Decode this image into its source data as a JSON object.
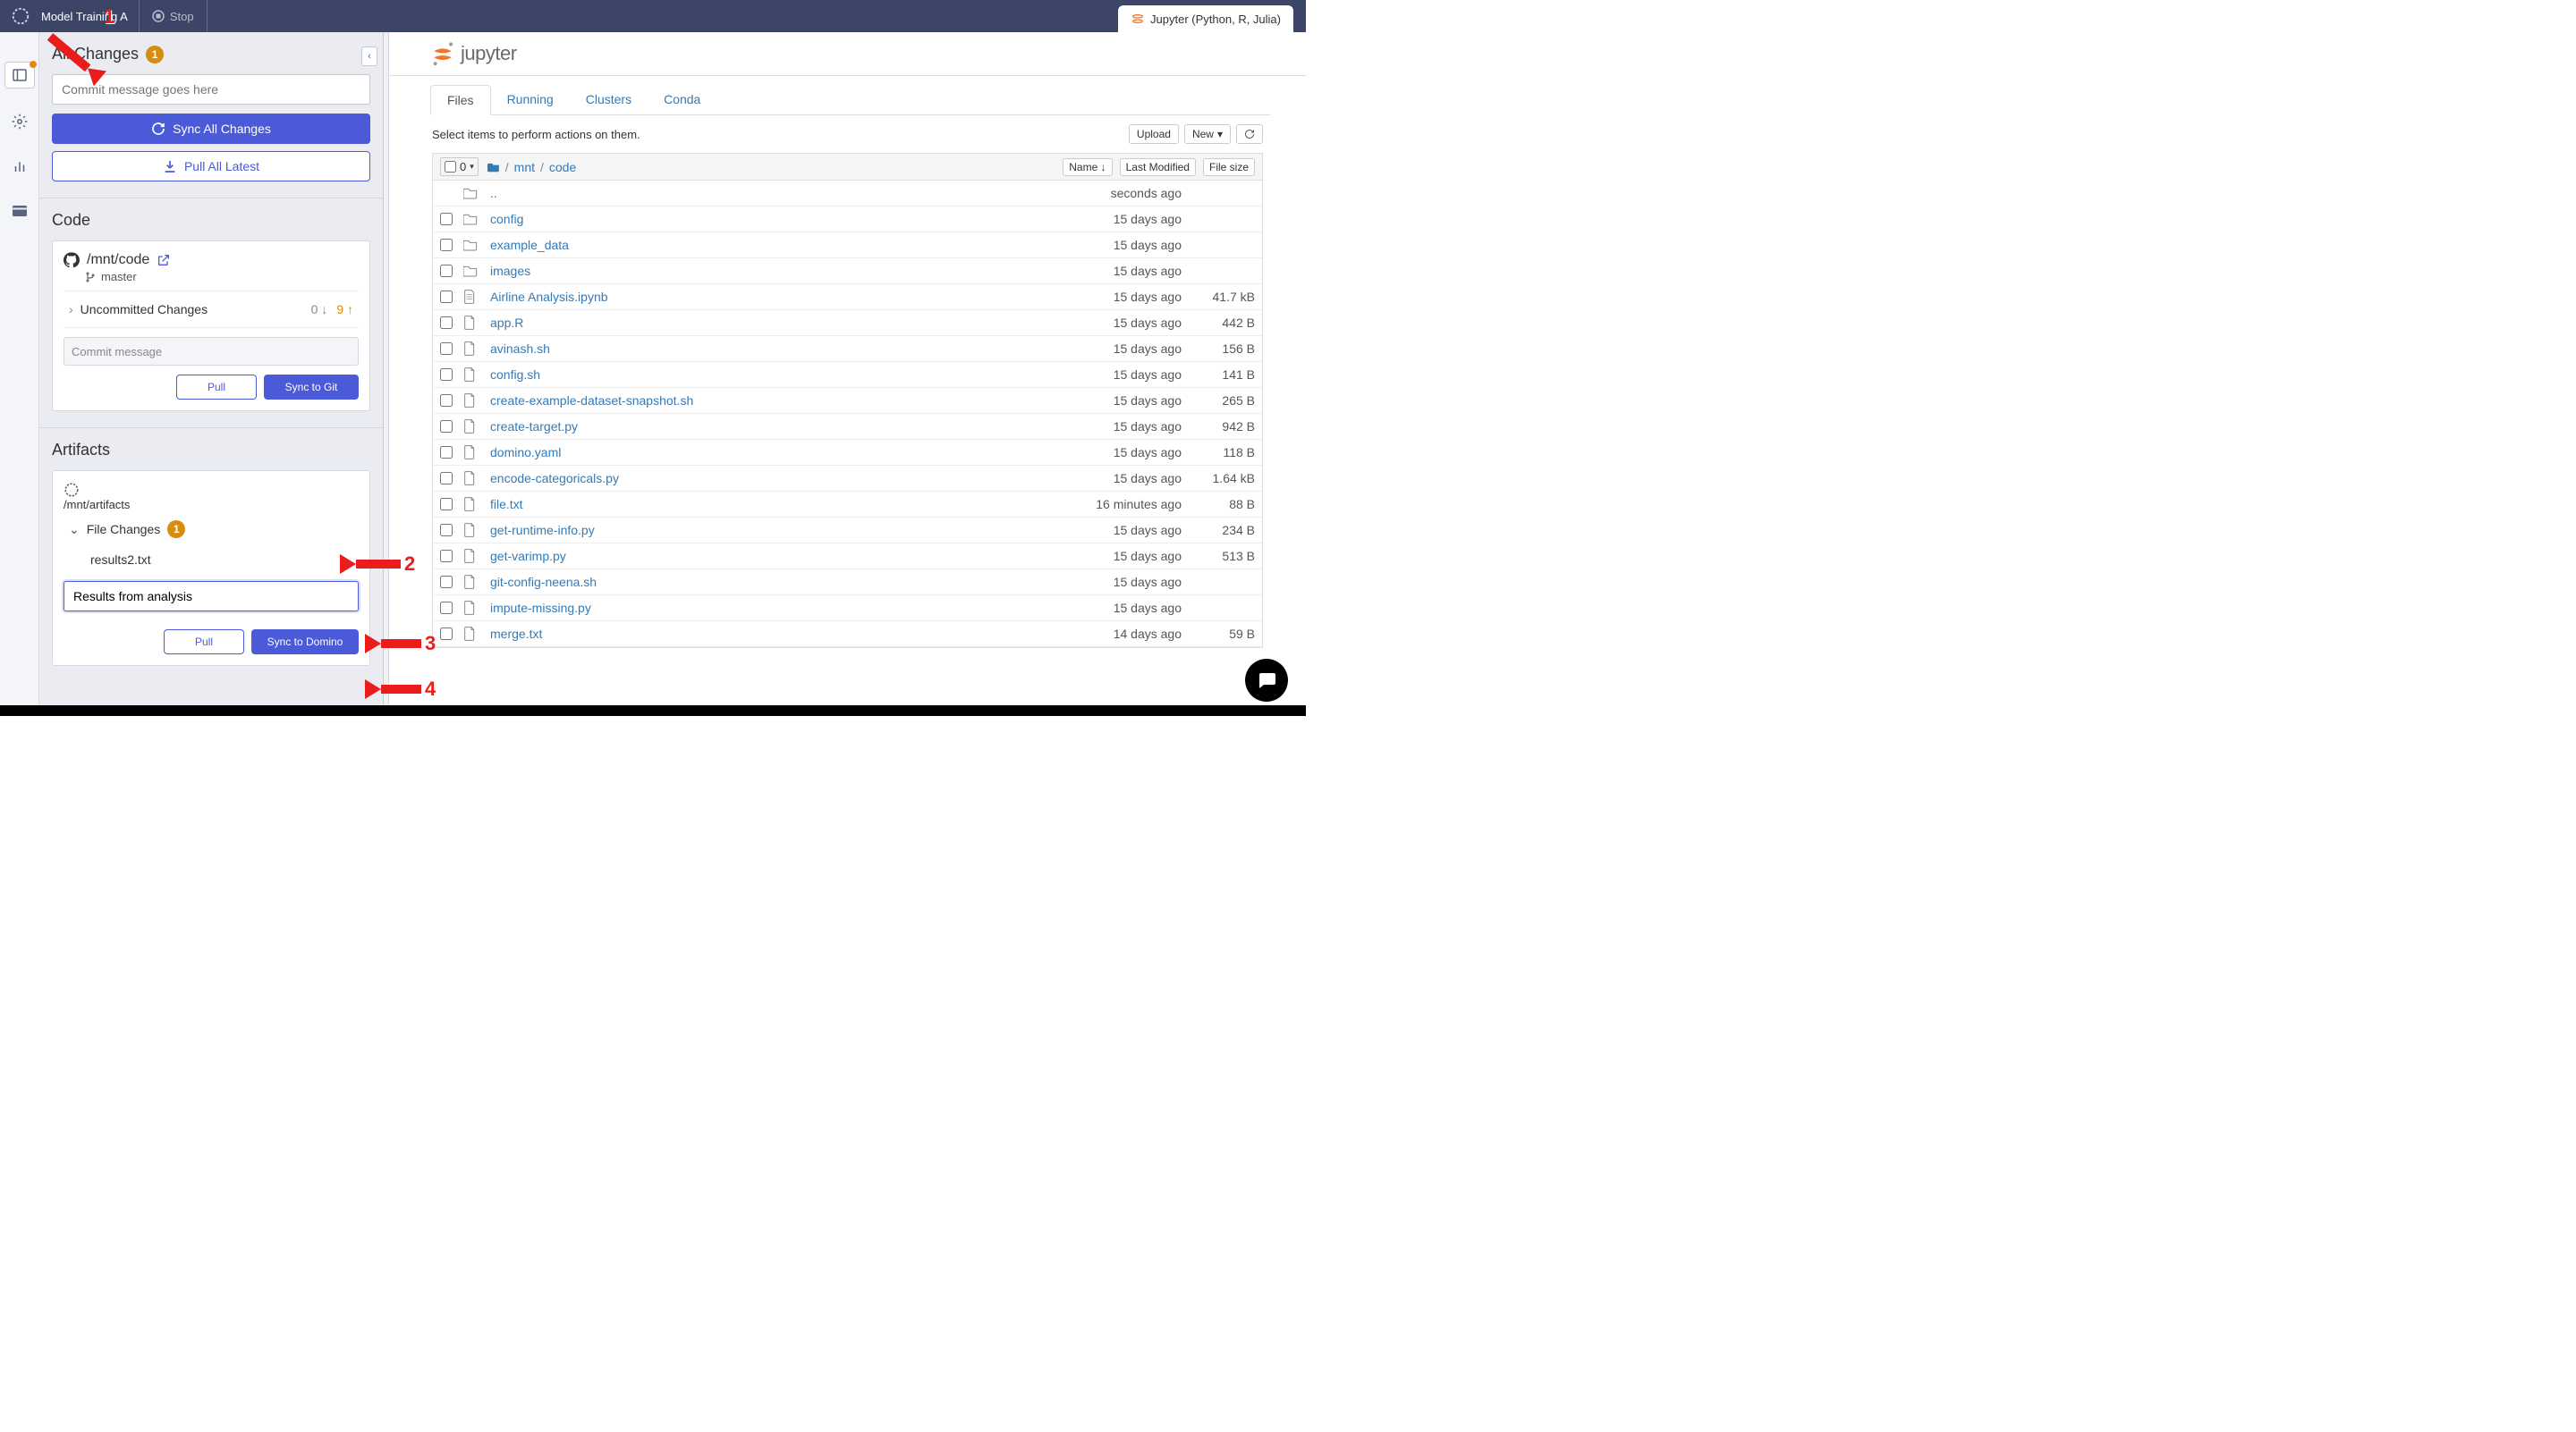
{
  "topbar": {
    "project_title": "Model Training A",
    "stop_label": "Stop",
    "tab_right": "Jupyter (Python, R, Julia)"
  },
  "panel": {
    "all_changes": {
      "title": "All Changes",
      "badge": "1",
      "commit_placeholder": "Commit message goes here",
      "sync_label": "Sync All Changes",
      "pull_label": "Pull All Latest"
    },
    "code": {
      "title": "Code",
      "path": "/mnt/code",
      "branch": "master",
      "uncommitted_label": "Uncommitted Changes",
      "incoming": "0",
      "outgoing": "9",
      "commit_placeholder": "Commit message",
      "pull_label": "Pull",
      "sync_label": "Sync to Git"
    },
    "artifacts": {
      "title": "Artifacts",
      "path": "/mnt/artifacts",
      "file_changes_label": "File Changes",
      "badge": "1",
      "file_name": "results2.txt",
      "commit_value": "Results from analysis",
      "pull_label": "Pull",
      "sync_label": "Sync to Domino"
    }
  },
  "jupyter": {
    "logo_text": "jupyter",
    "tabs": [
      "Files",
      "Running",
      "Clusters",
      "Conda"
    ],
    "active_tab": "Files",
    "hint": "Select items to perform actions on them.",
    "upload_label": "Upload",
    "new_label": "New",
    "count_checked": "0",
    "breadcrumb": [
      "mnt",
      "code"
    ],
    "header_name": "Name",
    "header_modified": "Last Modified",
    "header_size": "File size",
    "rows": [
      {
        "type": "up",
        "name": "..",
        "modified": "seconds ago",
        "size": ""
      },
      {
        "type": "folder",
        "name": "config",
        "modified": "15 days ago",
        "size": ""
      },
      {
        "type": "folder",
        "name": "example_data",
        "modified": "15 days ago",
        "size": ""
      },
      {
        "type": "folder",
        "name": "images",
        "modified": "15 days ago",
        "size": ""
      },
      {
        "type": "notebook",
        "name": "Airline Analysis.ipynb",
        "modified": "15 days ago",
        "size": "41.7 kB"
      },
      {
        "type": "file",
        "name": "app.R",
        "modified": "15 days ago",
        "size": "442 B"
      },
      {
        "type": "file",
        "name": "avinash.sh",
        "modified": "15 days ago",
        "size": "156 B"
      },
      {
        "type": "file",
        "name": "config.sh",
        "modified": "15 days ago",
        "size": "141 B"
      },
      {
        "type": "file",
        "name": "create-example-dataset-snapshot.sh",
        "modified": "15 days ago",
        "size": "265 B"
      },
      {
        "type": "file",
        "name": "create-target.py",
        "modified": "15 days ago",
        "size": "942 B"
      },
      {
        "type": "file",
        "name": "domino.yaml",
        "modified": "15 days ago",
        "size": "118 B"
      },
      {
        "type": "file",
        "name": "encode-categoricals.py",
        "modified": "15 days ago",
        "size": "1.64 kB"
      },
      {
        "type": "file",
        "name": "file.txt",
        "modified": "16 minutes ago",
        "size": "88 B"
      },
      {
        "type": "file",
        "name": "get-runtime-info.py",
        "modified": "15 days ago",
        "size": "234 B"
      },
      {
        "type": "file",
        "name": "get-varimp.py",
        "modified": "15 days ago",
        "size": "513 B"
      },
      {
        "type": "file",
        "name": "git-config-neena.sh",
        "modified": "15 days ago",
        "size": ""
      },
      {
        "type": "file",
        "name": "impute-missing.py",
        "modified": "15 days ago",
        "size": ""
      },
      {
        "type": "file",
        "name": "merge.txt",
        "modified": "14 days ago",
        "size": "59 B"
      }
    ]
  },
  "annotations": {
    "n1": "1",
    "n2": "2",
    "n3": "3",
    "n4": "4"
  }
}
